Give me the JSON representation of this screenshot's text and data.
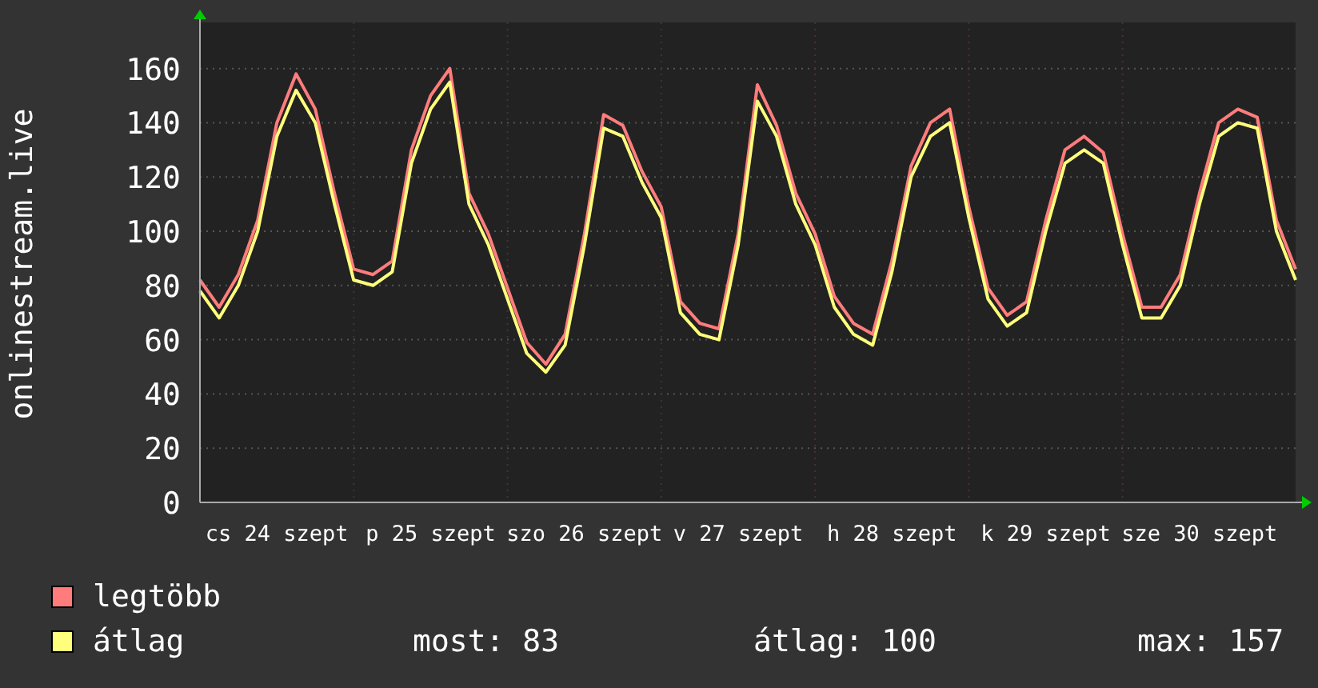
{
  "graph": {
    "chart_data": {
      "type": "line",
      "grid": true,
      "ylabel": "onlinestream.live",
      "categories": [
        null,
        null,
        null,
        null,
        "cs 24 szept",
        null,
        null,
        null,
        null,
        null,
        null,
        null,
        "p 25 szept",
        null,
        null,
        null,
        null,
        null,
        null,
        null,
        "szo 26 szept",
        null,
        null,
        null,
        null,
        null,
        null,
        null,
        "v 27 szept",
        null,
        null,
        null,
        null,
        null,
        null,
        null,
        "h 28 szept",
        null,
        null,
        null,
        null,
        null,
        null,
        null,
        "k 29 szept",
        null,
        null,
        null,
        null,
        null,
        null,
        null,
        "sze 30 szept",
        null,
        null,
        null,
        null,
        null
      ],
      "ylim": [
        0,
        177
      ],
      "yticks": [
        0,
        20,
        40,
        60,
        80,
        100,
        120,
        140,
        160
      ],
      "series": [
        {
          "name": "legtöbb",
          "color": "#ff7c7c",
          "values": [
            82,
            72,
            84,
            104,
            140,
            158,
            145,
            114,
            86,
            84,
            89,
            130,
            150,
            160,
            114,
            99,
            79,
            59,
            51,
            62,
            99,
            143,
            139,
            122,
            109,
            74,
            66,
            64,
            99,
            154,
            139,
            114,
            99,
            76,
            66,
            62,
            89,
            124,
            140,
            145,
            109,
            79,
            69,
            74,
            104,
            130,
            135,
            129,
            99,
            72,
            72,
            84,
            114,
            140,
            145,
            142,
            104,
            86
          ]
        },
        {
          "name": "átlag",
          "color": "#ffff7c",
          "values": [
            78,
            68,
            80,
            100,
            135,
            152,
            140,
            110,
            82,
            80,
            85,
            125,
            145,
            155,
            110,
            95,
            75,
            55,
            48,
            58,
            95,
            138,
            135,
            118,
            105,
            70,
            62,
            60,
            95,
            148,
            135,
            110,
            95,
            72,
            62,
            58,
            85,
            120,
            135,
            140,
            105,
            75,
            65,
            70,
            100,
            125,
            130,
            125,
            95,
            68,
            68,
            80,
            110,
            135,
            140,
            138,
            100,
            82
          ]
        }
      ]
    }
  },
  "stats": [
    "most: 83",
    "átlag: 100",
    "max: 157"
  ]
}
